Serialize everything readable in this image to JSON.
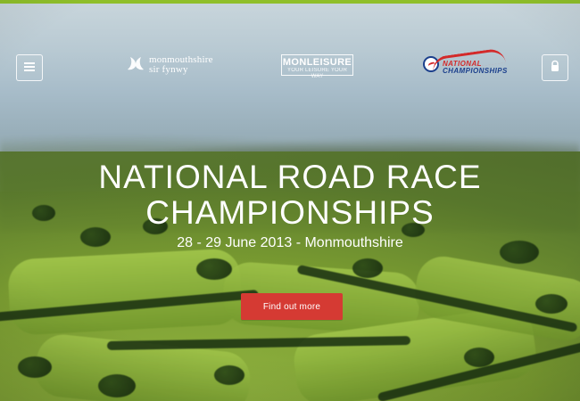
{
  "header": {
    "menu_icon": "menu-icon",
    "lock_icon": "lock-icon",
    "logos": {
      "monmouthshire": {
        "line1": "monmouthshire",
        "line2": "sir fynwy"
      },
      "monleisure": {
        "name": "MONLEISURE",
        "tagline": "YOUR LEISURE YOUR WAY"
      },
      "national_championships": {
        "line1": "NATIONAL",
        "line2": "CHAMPIONSHIPS"
      }
    }
  },
  "hero": {
    "title_line1": "NATIONAL ROAD RACE",
    "title_line2": "CHAMPIONSHIPS",
    "subtitle": "28 - 29 June 2013 - Monmouthshire",
    "cta_label": "Find out more"
  },
  "colors": {
    "accent_bar": "#8fbf2a",
    "cta": "#d53a33",
    "text": "#ffffff"
  }
}
